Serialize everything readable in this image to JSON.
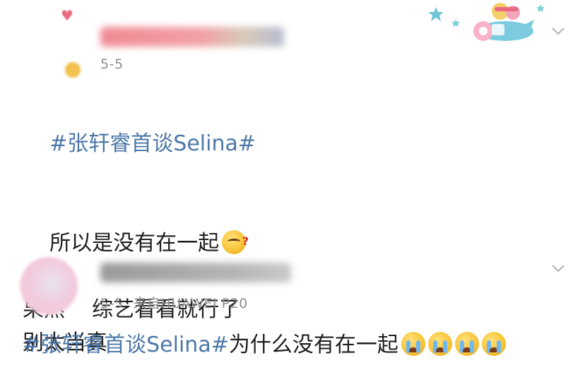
{
  "posts": [
    {
      "username": "",
      "date": "5-5",
      "source": "",
      "lines": [
        {
          "hashtag": "#张轩睿首谈Selina#",
          "text": "",
          "emojis": []
        },
        {
          "hashtag": "",
          "text": "所以是没有在一起",
          "emojis": [
            "confused-face"
          ]
        },
        {
          "hashtag": "",
          "text": "果然    综艺看看就行了",
          "emojis": []
        },
        {
          "hashtag": "",
          "text": "别太当真",
          "emojis": []
        }
      ]
    },
    {
      "username": "",
      "date": "5-5",
      "source": "来自HUAWEI P20",
      "lines": [
        {
          "hashtag": "#张轩睿首谈Selina#",
          "text": "为什么没有在一起",
          "emojis": [
            "crying-face",
            "crying-face",
            "crying-face",
            "crying-face"
          ]
        }
      ]
    }
  ],
  "colors": {
    "hashtag": "#4d78a8",
    "meta": "#8e8e8e",
    "chevron": "#b0b0b0"
  }
}
